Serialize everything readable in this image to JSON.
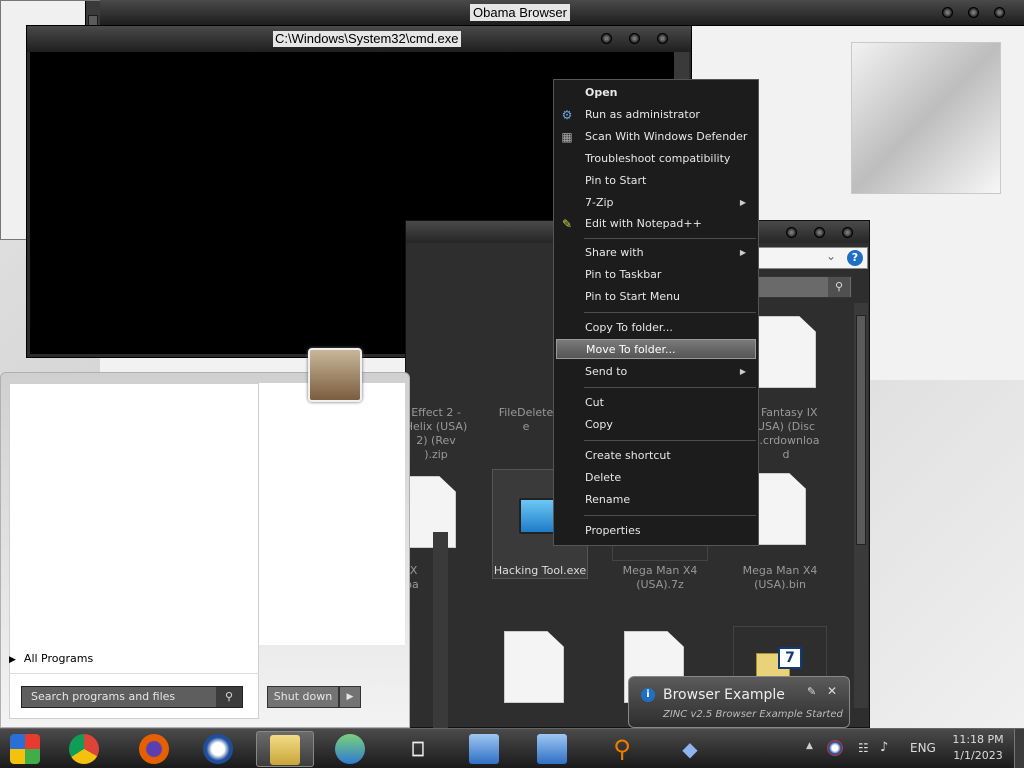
{
  "browser": {
    "title": "Obama Browser"
  },
  "cmd": {
    "title": "C:\\Windows\\System32\\cmd.exe"
  },
  "context_menu": {
    "items": [
      {
        "label": "Open",
        "bold": true
      },
      {
        "label": "Run as administrator",
        "icon": "shield-gear-icon"
      },
      {
        "label": "Scan With Windows Defender",
        "icon": "defender-icon"
      },
      {
        "label": "Troubleshoot compatibility"
      },
      {
        "label": "Pin to Start"
      },
      {
        "label": "7-Zip",
        "submenu": true
      },
      {
        "label": "Edit with Notepad++",
        "icon": "notepadpp-icon"
      },
      {
        "label": "Share with",
        "submenu": true
      },
      {
        "label": "Pin to Taskbar"
      },
      {
        "label": "Pin to Start Menu"
      },
      {
        "label": "Copy To folder..."
      },
      {
        "label": "Move To folder...",
        "highlighted": true
      },
      {
        "label": "Send to",
        "submenu": true
      },
      {
        "label": "Cut"
      },
      {
        "label": "Copy"
      },
      {
        "label": "Create shortcut"
      },
      {
        "label": "Delete"
      },
      {
        "label": "Rename"
      },
      {
        "label": "Properties"
      }
    ]
  },
  "explorer": {
    "items": [
      {
        "label": "Effect 2 - Helix (USA) 2) (Rev .zip",
        "lines": [
          "Effect 2 -",
          "Helix (USA)",
          "2) (Rev",
          ").zip"
        ]
      },
      {
        "label": "FileDelete",
        "lines": [
          "FileDelete",
          "e"
        ]
      },
      {
        "label": "Fantasy IX (USA) (Disc .crdownload",
        "lines": [
          "l Fantasy IX",
          "USA) (Disc",
          "b.crdownloa",
          "d"
        ]
      },
      {
        "label": "IX oa",
        "lines": [
          "IX",
          "",
          "oa"
        ]
      },
      {
        "label": "Hacking Tool.exe",
        "lines": [
          "Hacking Tool.exe"
        ]
      },
      {
        "label": "Mega Man X4 (USA).7z",
        "lines": [
          "Mega Man X4",
          "(USA).7z"
        ]
      },
      {
        "label": "Mega Man X4 (USA).bin",
        "lines": [
          "Mega Man X4",
          "(USA).bin"
        ]
      }
    ],
    "help_icon": "?"
  },
  "start_menu": {
    "all_programs": "All Programs",
    "search_placeholder": "Search programs and files",
    "shutdown_label": "Shut down"
  },
  "notification": {
    "title": "Browser Example",
    "body": "ZINC v2.5 Browser Example Started"
  },
  "taskbar": {
    "apps": [
      {
        "name": "windows-start-icon",
        "color": "#2a6fd6"
      },
      {
        "name": "chrome-icon",
        "color": "#db4437"
      },
      {
        "name": "firefox-icon",
        "color": "#e66000"
      },
      {
        "name": "obama-browser-icon",
        "color": "#1f4e9c"
      },
      {
        "name": "file-explorer-icon",
        "color": "#d8b84a",
        "active": true
      },
      {
        "name": "messenger-icon",
        "color": "#4aa84a"
      },
      {
        "name": "gamepad-icon",
        "color": "#cfcfcf"
      },
      {
        "name": "network-app-icon",
        "color": "#3d7bd0"
      },
      {
        "name": "network-app-2-icon",
        "color": "#3d7bd0"
      },
      {
        "name": "search-magnifier-icon",
        "color": "#f07b00"
      },
      {
        "name": "diamond-app-icon",
        "color": "#5a87d6"
      }
    ],
    "language": "ENG",
    "time": "11:18 PM",
    "date": "1/1/2023"
  }
}
